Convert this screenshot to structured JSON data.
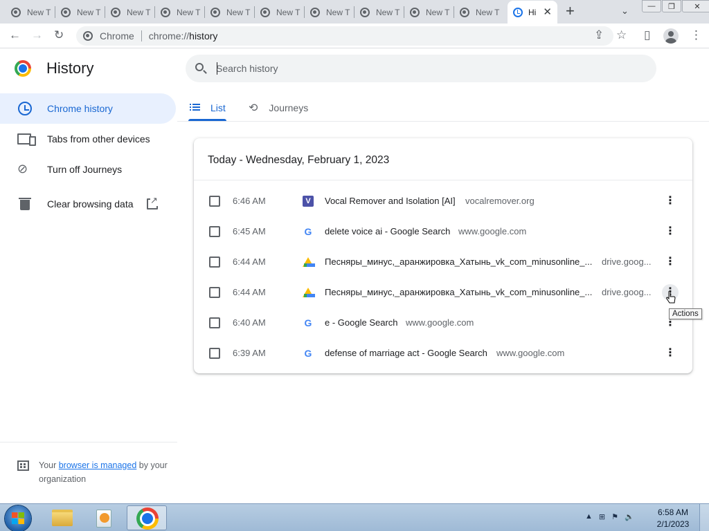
{
  "browser": {
    "tabs": [
      {
        "label": "New T"
      },
      {
        "label": "New T"
      },
      {
        "label": "New T"
      },
      {
        "label": "New T"
      },
      {
        "label": "New T"
      },
      {
        "label": "New T"
      },
      {
        "label": "New T"
      },
      {
        "label": "New T"
      },
      {
        "label": "New T"
      },
      {
        "label": "New T"
      }
    ],
    "active_tab": {
      "label": "Hi",
      "close": "✕"
    },
    "new_tab": "+",
    "tab_search": "⌄",
    "window_controls": {
      "minimize": "—",
      "maximize": "❐",
      "close": "✕"
    },
    "toolbar": {
      "back": "←",
      "forward": "→",
      "reload": "↻",
      "share": "⇪",
      "bookmark": "☆",
      "side_panel": "▯",
      "menu": "⋮"
    },
    "omnibox": {
      "chip": "Chrome",
      "url_scheme": "chrome://",
      "url_host": "history"
    }
  },
  "page": {
    "title": "History",
    "search_placeholder": "Search history",
    "sidebar": {
      "items": [
        {
          "label": "Chrome history"
        },
        {
          "label": "Tabs from other devices"
        },
        {
          "label": "Turn off Journeys"
        },
        {
          "label": "Clear browsing data"
        }
      ],
      "managed": {
        "prefix": "Your ",
        "link": "browser is managed",
        "suffix": " by your organization"
      }
    },
    "tabs": [
      {
        "label": "List"
      },
      {
        "label": "Journeys"
      }
    ],
    "card": {
      "date_title": "Today - Wednesday, February 1, 2023",
      "rows": [
        {
          "time": "6:46 AM",
          "title": "Vocal Remover and Isolation [AI]",
          "domain": "vocalremover.org",
          "favicon": "V"
        },
        {
          "time": "6:45 AM",
          "title": "delete voice ai - Google Search",
          "domain": "www.google.com",
          "favicon": "G"
        },
        {
          "time": "6:44 AM",
          "title": "Песняры_минус,_аранжировка_Хатынь_vk_com_minusonline_...",
          "domain": "drive.goog...",
          "favicon": ""
        },
        {
          "time": "6:44 AM",
          "title": "Песняры_минус,_аранжировка_Хатынь_vk_com_minusonline_...",
          "domain": "drive.goog...",
          "favicon": ""
        },
        {
          "time": "6:40 AM",
          "title": "e - Google Search",
          "domain": "www.google.com",
          "favicon": "G"
        },
        {
          "time": "6:39 AM",
          "title": "defense of marriage act - Google Search",
          "domain": "www.google.com",
          "favicon": "G"
        }
      ],
      "menu_glyph": "⋮"
    },
    "tooltip": "Actions"
  },
  "taskbar": {
    "tray_icons": [
      "▲",
      "⊞",
      "⚑",
      "🔈"
    ],
    "clock_time": "6:58 AM",
    "clock_date": "2/1/2023"
  },
  "colors": {
    "accent": "#1967d2",
    "selected_bg": "#e8f0fe"
  }
}
